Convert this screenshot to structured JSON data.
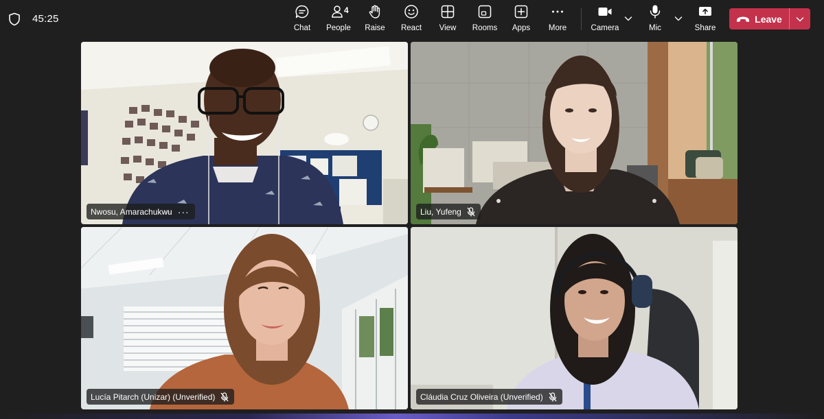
{
  "meeting": {
    "timer": "45:25"
  },
  "toolbar": {
    "chat_label": "Chat",
    "people_label": "People",
    "people_count": "4",
    "raise_label": "Raise",
    "react_label": "React",
    "view_label": "View",
    "rooms_label": "Rooms",
    "apps_label": "Apps",
    "more_label": "More",
    "camera_label": "Camera",
    "mic_label": "Mic",
    "share_label": "Share",
    "leave_label": "Leave"
  },
  "participants": [
    {
      "name": "Nwosu, Amarachukwu",
      "muted": false,
      "has_more_menu": true
    },
    {
      "name": "Liu, Yufeng",
      "muted": true,
      "has_more_menu": false
    },
    {
      "name": "Lucía Pitarch (Unizar) (Unverified)",
      "muted": true,
      "has_more_menu": false
    },
    {
      "name": "Cláudia Cruz Oliveira (Unverified)",
      "muted": true,
      "has_more_menu": false
    }
  ],
  "colors": {
    "background": "#1f1f1f",
    "leave_button": "#c4314b",
    "toolbar_text": "#ffffff"
  },
  "icons": {
    "shield": "shield-icon",
    "chat": "chat-bubble-icon",
    "people": "people-icon",
    "raise": "raise-hand-icon",
    "react": "smiley-icon",
    "view": "grid-view-icon",
    "rooms": "rooms-icon",
    "apps": "apps-plus-icon",
    "more": "ellipsis-icon",
    "camera": "camera-icon",
    "mic": "microphone-icon",
    "share": "share-tray-icon",
    "leave": "phone-hangup-icon",
    "muted": "mic-off-icon"
  }
}
